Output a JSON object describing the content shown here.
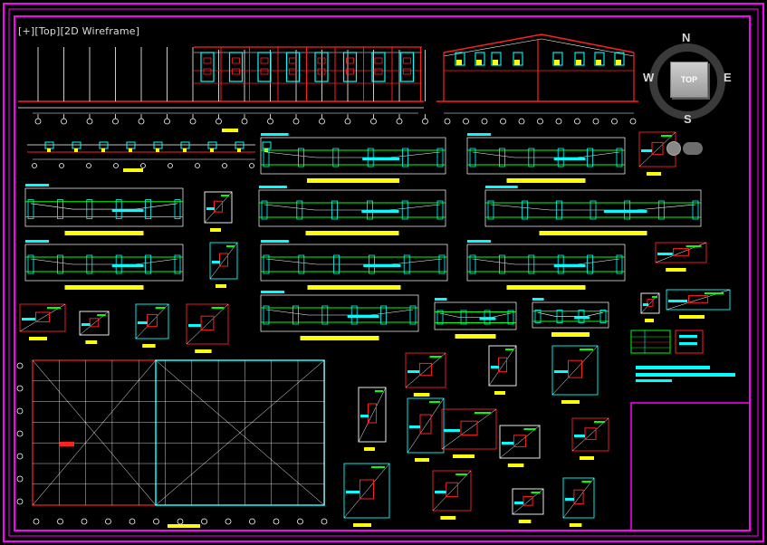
{
  "viewport": {
    "label_prefix": "[+]",
    "label_view": "[Top]",
    "label_style": "[2D Wireframe]"
  },
  "viewcube": {
    "north": "N",
    "south": "S",
    "east": "E",
    "west": "W",
    "face": "TOP"
  },
  "wcs": {
    "label": ""
  },
  "colors": {
    "background": "#000000",
    "frame": "#ff00ff",
    "line_red": "#ff2020",
    "line_cyan": "#00ffff",
    "line_green": "#00ff00",
    "line_white": "#ffffff",
    "line_yellow": "#ffff00"
  }
}
